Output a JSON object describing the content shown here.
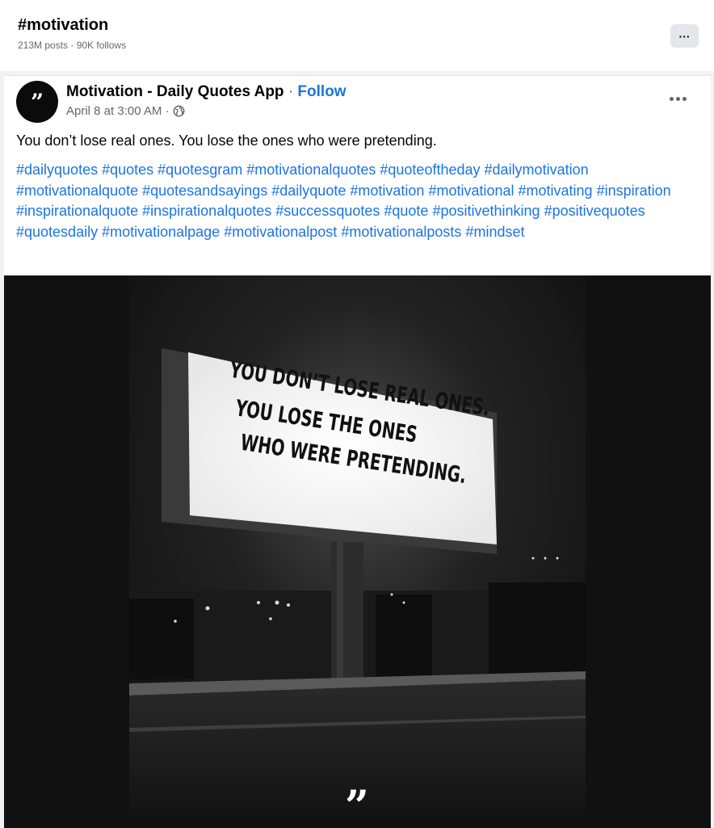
{
  "header": {
    "title": "#motivation",
    "meta": "213M posts · 90K follows",
    "more_label": "···"
  },
  "post": {
    "avatar_glyph": "”",
    "author": "Motivation - Daily Quotes App",
    "separator": "·",
    "follow_label": "Follow",
    "timestamp": "April 8 at 3:00 AM ·",
    "caption": "You don’t lose real ones. You lose the ones who were pretending.",
    "hashtags": [
      "#dailyquotes",
      "#quotes",
      "#quotesgram",
      "#motivationalquotes",
      "#quoteoftheday",
      "#dailymotivation",
      "#motivationalquote",
      "#quotesandsayings",
      "#dailyquote",
      "#motivation",
      "#motivational",
      "#motivating",
      "#inspiration",
      "#inspirationalquote",
      "#inspirationalquotes",
      "#successquotes",
      "#quote",
      "#positivethinking",
      "#positivequotes",
      "#quotesdaily",
      "#motivationalpage",
      "#motivationalpost",
      "#motivationalposts",
      "#mindset"
    ],
    "image": {
      "billboard_lines": [
        "YOU DON’T LOSE REAL ONES.",
        "YOU LOSE THE ONES",
        "WHO WERE PRETENDING."
      ],
      "quote_mark": "”"
    }
  },
  "icons": {
    "top_more": "more-icon",
    "avatar": "quote-mark-icon",
    "audience": "globe-icon",
    "post_more": "more-horizontal-icon"
  }
}
